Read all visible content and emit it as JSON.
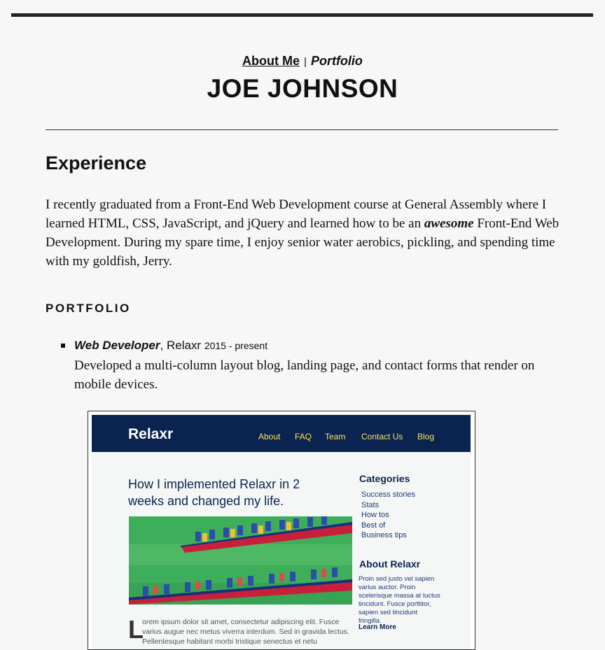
{
  "nav": {
    "about": "About Me",
    "separator": "|",
    "portfolio": "Portfolio"
  },
  "header": {
    "name": "JOE JOHNSON"
  },
  "experience": {
    "heading": "Experience",
    "bio_1": "I recently graduated from a Front-End Web Development course at General Assembly where I learned HTML, CSS, JavaScript, and jQuery and learned how to be an ",
    "bio_emph": "awesome",
    "bio_2": " Front-End Web Development. During my spare time, I enjoy senior water aerobics, pickling, and spending time with my goldfish, Jerry."
  },
  "portfolio": {
    "heading": "PORTFOLIO",
    "job": {
      "title": "Web Developer",
      "company": ", Relaxr ",
      "dates": "2015 - present",
      "description": "Developed a multi-column layout blog, landing page, and contact forms that render on mobile devices."
    }
  },
  "screenshot": {
    "logo": "Relaxr",
    "nav": [
      "About",
      "FAQ",
      "Team",
      "Contact Us",
      "Blog"
    ],
    "post_title": "How I implemented Relaxr in 2 weeks and changed my life.",
    "dropcap": "L",
    "body_text": "orem ipsum dolor sit amet, consectetur adipiscing elit. Fusce varius augue nec metus viverra interdum. Sed in gravida lectus. Pellentesque habitant morbi tristique senectus et netu",
    "categories_heading": "Categories",
    "categories": [
      "Success stories",
      "Stats",
      "How tos",
      "Best of",
      "Business tips"
    ],
    "about_heading": "About Relaxr",
    "about_text": "Proin sed justo vel sapien varius auctor. Proin scelerisque massa at luctus tincidunt. Fusce porttitor, sapien sed tincidunt fringilla.",
    "learn_more": "Learn More",
    "colors": {
      "header": "#0b2350",
      "nav": "#f3e55a",
      "water": "#3fae5a",
      "boat": "#c8203a"
    }
  }
}
